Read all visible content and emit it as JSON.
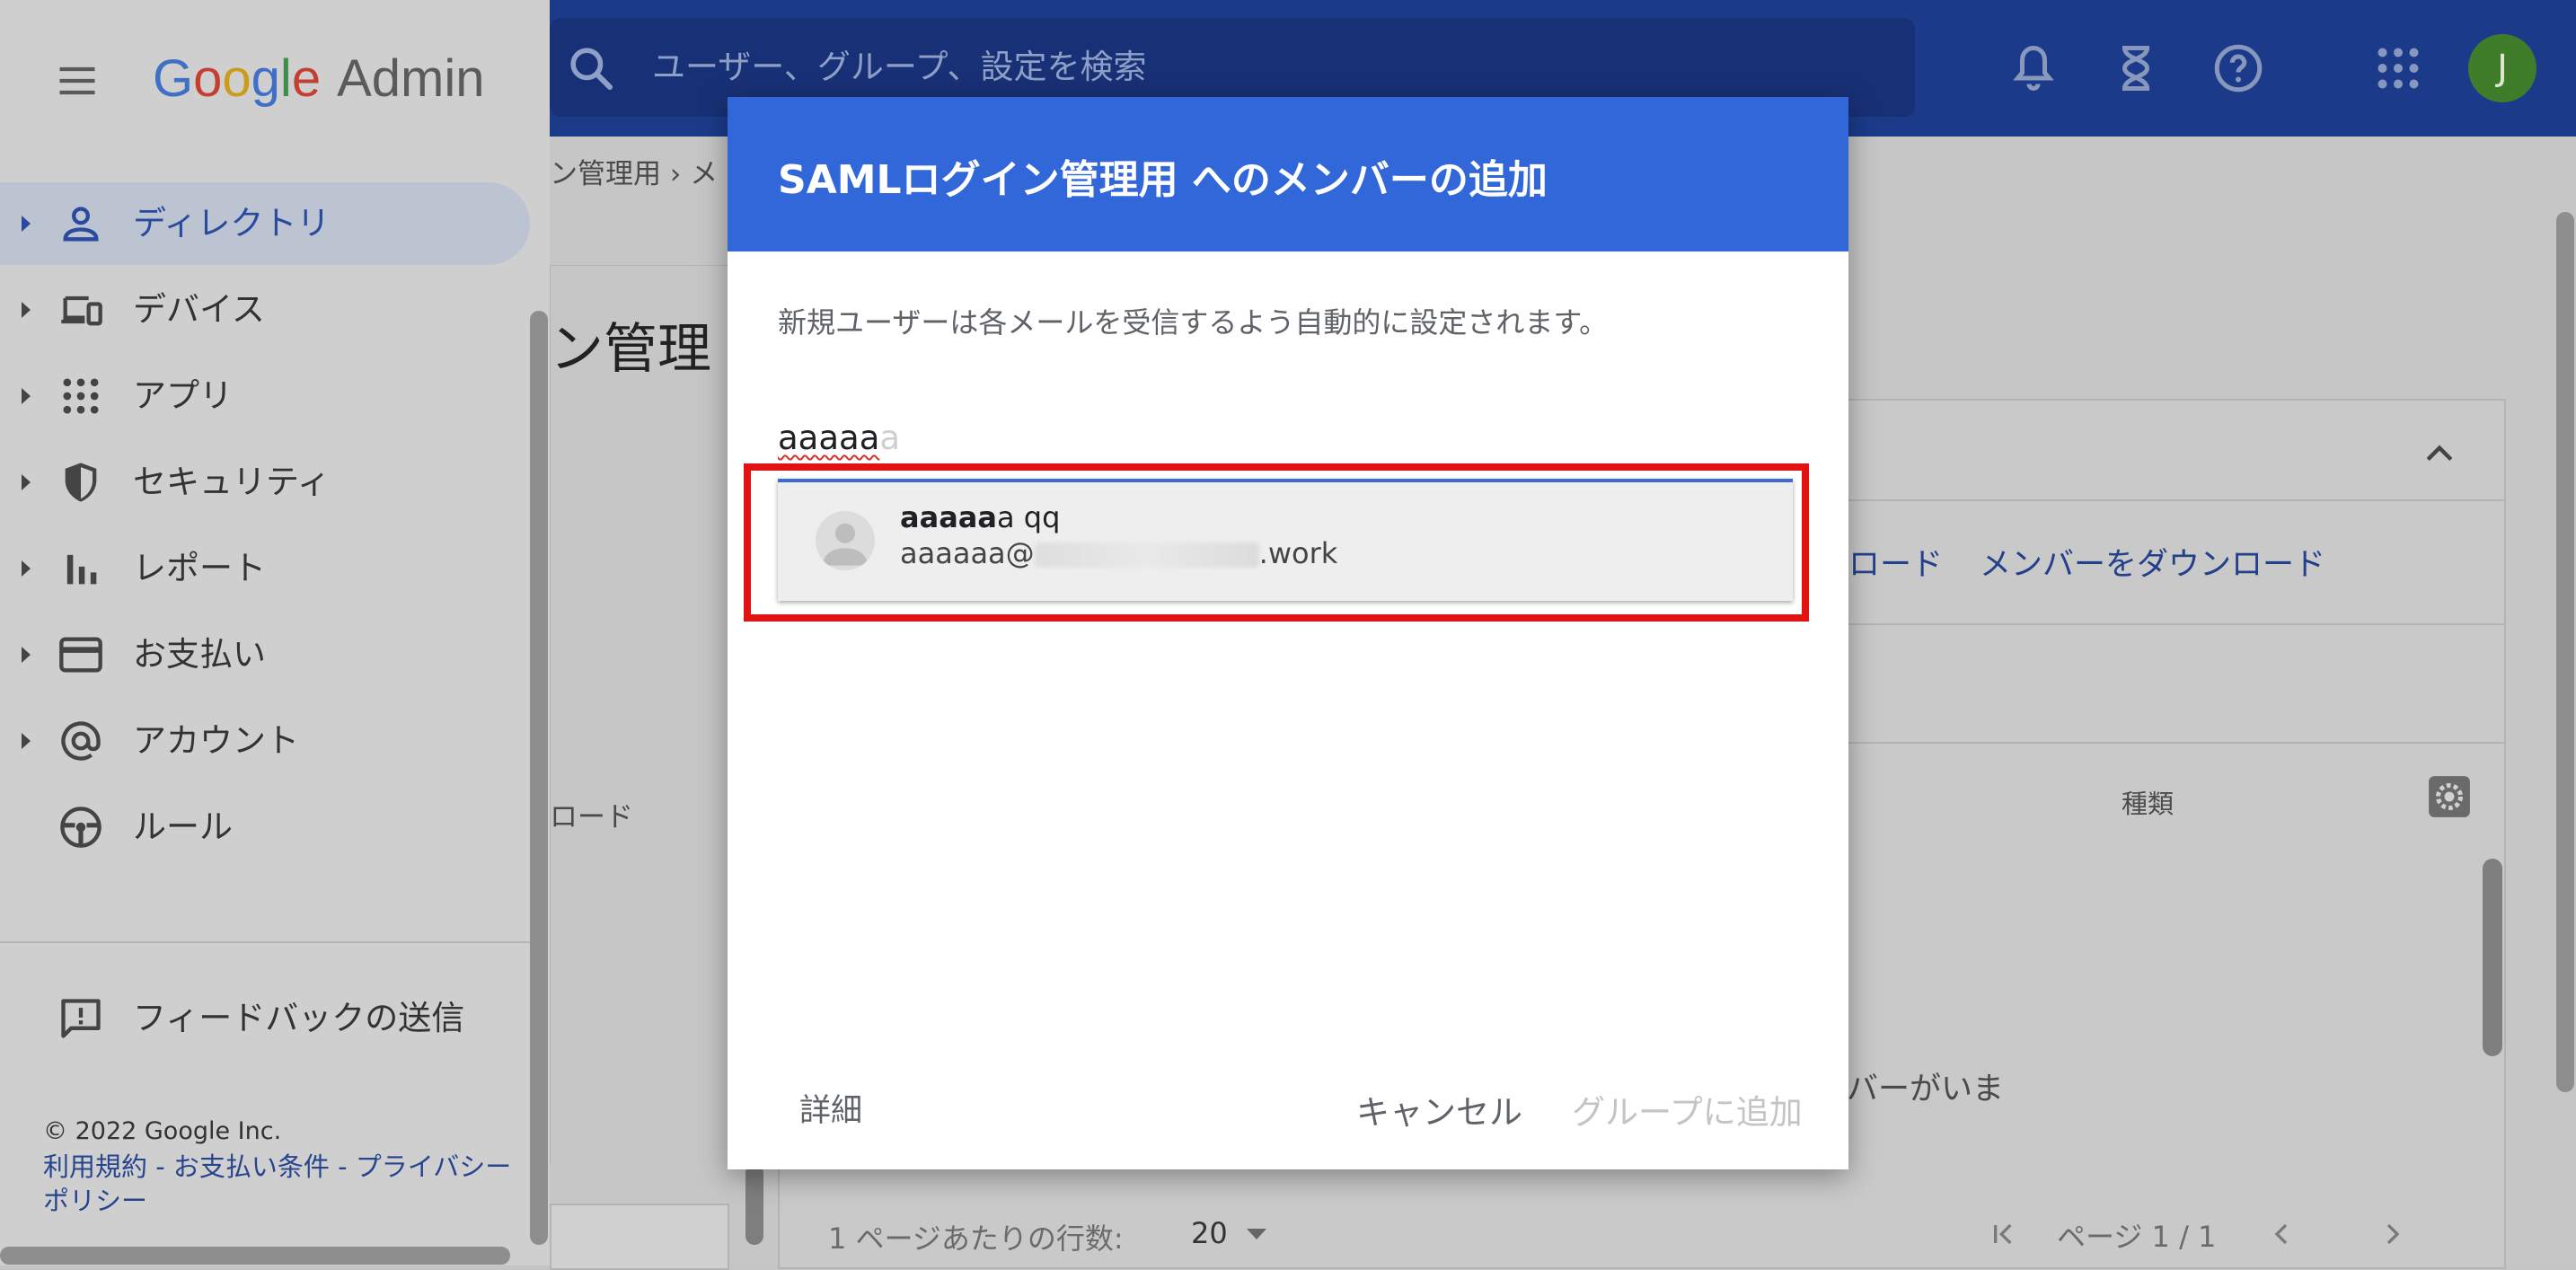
{
  "header": {
    "search_placeholder": "ユーザー、グループ、設定を検索",
    "avatar_initial": "J"
  },
  "logo": {
    "brand": [
      "G",
      "o",
      "o",
      "g",
      "l",
      "e"
    ],
    "product": "Admin"
  },
  "sidebar": {
    "items": [
      {
        "label": "ディレクトリ",
        "icon": "person-icon",
        "active": true,
        "expandable": true
      },
      {
        "label": "デバイス",
        "icon": "devices-icon",
        "active": false,
        "expandable": true
      },
      {
        "label": "アプリ",
        "icon": "apps-grid-icon",
        "active": false,
        "expandable": true
      },
      {
        "label": "セキュリティ",
        "icon": "shield-icon",
        "active": false,
        "expandable": true
      },
      {
        "label": "レポート",
        "icon": "bar-chart-icon",
        "active": false,
        "expandable": true
      },
      {
        "label": "お支払い",
        "icon": "credit-card-icon",
        "active": false,
        "expandable": true
      },
      {
        "label": "アカウント",
        "icon": "at-sign-icon",
        "active": false,
        "expandable": true
      },
      {
        "label": "ルール",
        "icon": "steering-wheel-icon",
        "active": false,
        "expandable": false
      }
    ],
    "feedback_label": "フィードバックの送信",
    "copyright": "© 2022 Google Inc.",
    "footer_links": "利用規約 - お支払い条件 - プライバシー ポリシー"
  },
  "background": {
    "breadcrumb": "ン管理用 › メ",
    "page_title": "ン管理",
    "download_link_partial": "ロード",
    "download_members_link": "メンバーをダウンロード",
    "column_type": "種類",
    "code_label_partial": "ロード",
    "empty_message_partial": "バーがいま",
    "rows_per_page_label": "1 ページあたりの行数:",
    "rows_per_page_value": "20",
    "page_indicator": "ページ 1 / 1"
  },
  "dialog": {
    "title": "SAMLログイン管理用 へのメンバーの追加",
    "description": "新規ユーザーは各メールを受信するよう自動的に設定されます。",
    "input_value": "aaaaa",
    "input_hint": "a",
    "suggestion": {
      "name_bold": "aaaaa",
      "name_rest": "a qq",
      "email_prefix": "aaaaa",
      "email_visible_start": "a@",
      "email_suffix": ".work"
    },
    "details_button": "詳細",
    "cancel_button": "キャンセル",
    "add_button": "グループに追加"
  },
  "colors": {
    "header_blue": "#3167d9",
    "highlight_red": "#e31212",
    "link_blue": "#27448f"
  }
}
